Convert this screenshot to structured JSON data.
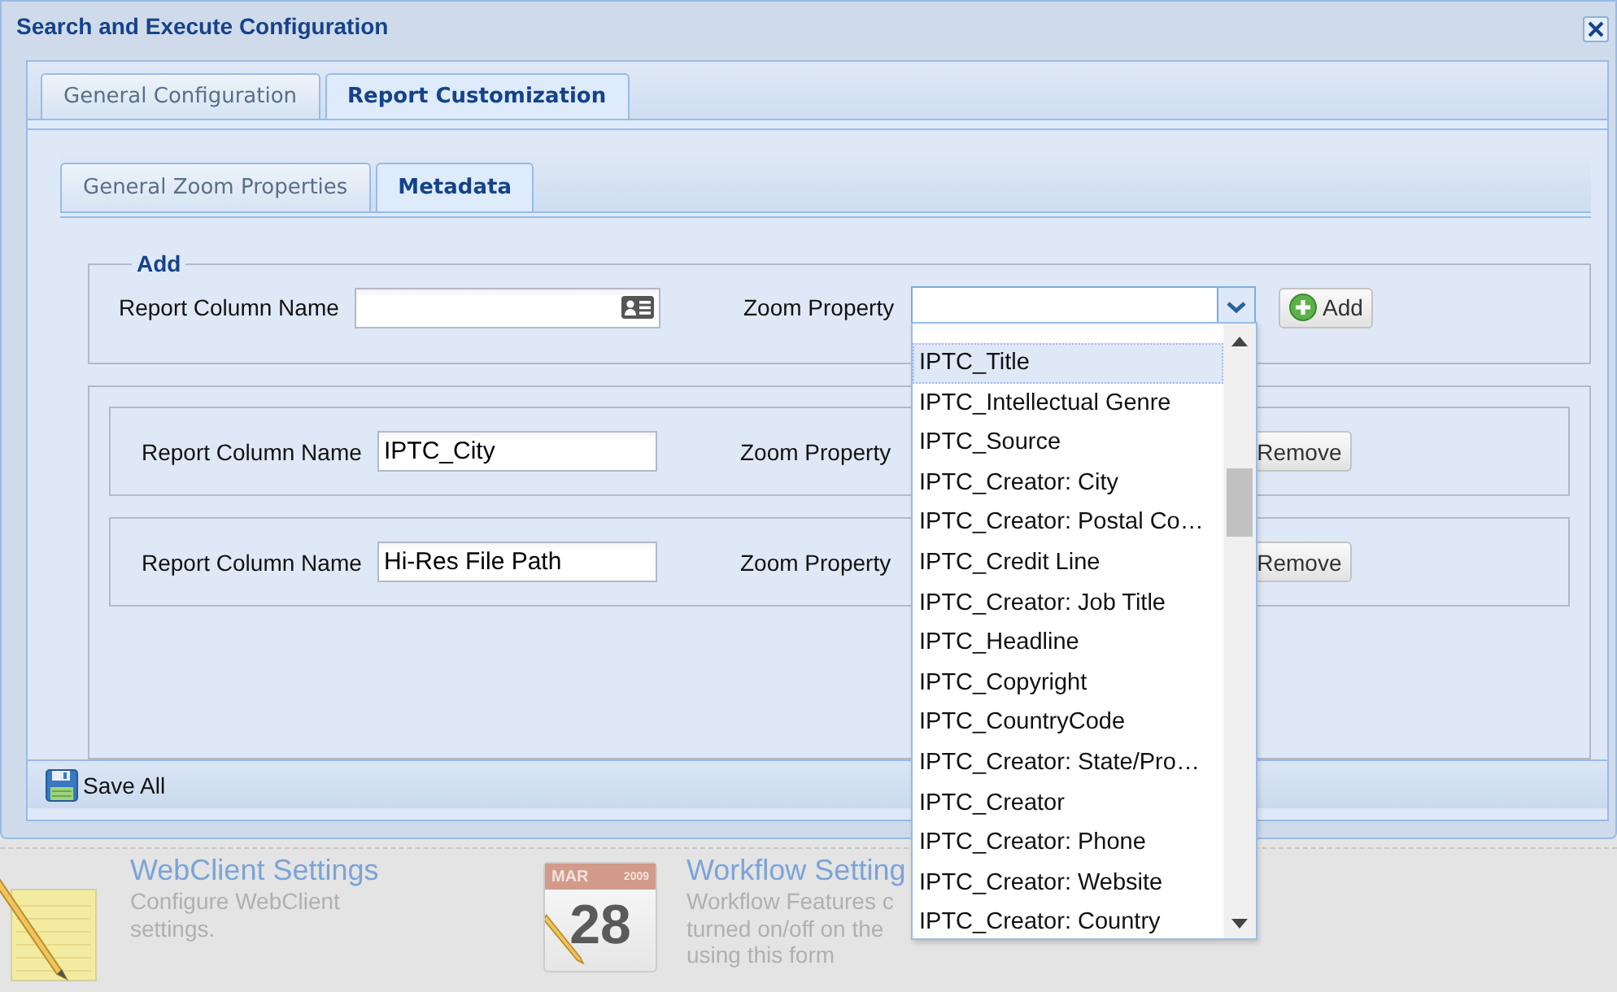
{
  "window": {
    "title": "Search and Execute Configuration"
  },
  "tabs": [
    {
      "label": "General Configuration",
      "selected": false
    },
    {
      "label": "Report Customization",
      "selected": true
    }
  ],
  "subtabs": [
    {
      "label": "General Zoom Properties",
      "selected": false
    },
    {
      "label": "Metadata",
      "selected": true
    }
  ],
  "add_section": {
    "legend": "Add",
    "column_label": "Report Column Name",
    "property_label": "Zoom Property",
    "add_button": "Add"
  },
  "mappings": [
    {
      "column_label": "Report Column Name",
      "column_value": "IPTC_City",
      "property_label": "Zoom Property",
      "remove_button": "Remove"
    },
    {
      "column_label": "Report Column Name",
      "column_value": "Hi-Res File Path",
      "property_label": "Zoom Property",
      "remove_button": "Remove"
    }
  ],
  "dropdown": {
    "items": [
      {
        "label": "IPTC_Title",
        "selected": true
      },
      {
        "label": "IPTC_Intellectual Genre",
        "selected": false
      },
      {
        "label": "IPTC_Source",
        "selected": false
      },
      {
        "label": "IPTC_Creator: City",
        "selected": false
      },
      {
        "label": "IPTC_Creator: Postal Co…",
        "selected": false
      },
      {
        "label": "IPTC_Credit Line",
        "selected": false
      },
      {
        "label": "IPTC_Creator: Job Title",
        "selected": false
      },
      {
        "label": "IPTC_Headline",
        "selected": false
      },
      {
        "label": "IPTC_Copyright",
        "selected": false
      },
      {
        "label": "IPTC_CountryCode",
        "selected": false
      },
      {
        "label": "IPTC_Creator: State/Pro…",
        "selected": false
      },
      {
        "label": "IPTC_Creator",
        "selected": false
      },
      {
        "label": "IPTC_Creator: Phone",
        "selected": false
      },
      {
        "label": "IPTC_Creator: Website",
        "selected": false
      },
      {
        "label": "IPTC_Creator: Country",
        "selected": false
      }
    ]
  },
  "toolbar": {
    "save_button": "Save All"
  },
  "background": {
    "cards": [
      {
        "kind": "notepad",
        "title": "WebClient Settings",
        "lines": [
          "Configure WebClient",
          "settings."
        ]
      },
      {
        "kind": "calendar",
        "title": "Workflow Setting",
        "lines": [
          "Workflow Features c",
          "turned on/off on the",
          "using this form"
        ],
        "month": "MAR",
        "year": "2009",
        "day": "28"
      }
    ]
  }
}
